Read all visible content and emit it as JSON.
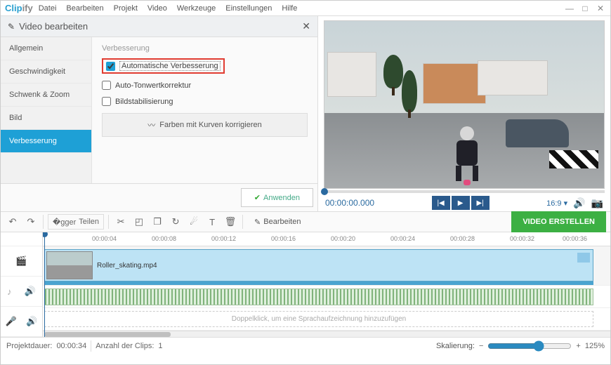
{
  "app": {
    "name1": "Clip",
    "name2": "ify"
  },
  "menu": [
    "Datei",
    "Bearbeiten",
    "Projekt",
    "Video",
    "Werkzeuge",
    "Einstellungen",
    "Hilfe"
  ],
  "panel": {
    "title": "Video bearbeiten",
    "tabs": [
      "Allgemein",
      "Geschwindigkeit",
      "Schwenk & Zoom",
      "Bild",
      "Verbesserung"
    ],
    "active_tab": 4,
    "group": "Verbesserung",
    "auto_enhance": "Automatische Verbesserung",
    "auto_tone": "Auto-Tonwertkorrektur",
    "stabilize": "Bildstabilisierung",
    "curves_btn": "Farben mit Kurven korrigieren",
    "apply": "Anwenden"
  },
  "preview": {
    "timecode": "00:00:00.000",
    "ratio": "16:9"
  },
  "toolbar": {
    "split": "Teilen",
    "edit": "Bearbeiten",
    "create": "VIDEO ERSTELLEN"
  },
  "timeline": {
    "ticks": [
      "00:00:04",
      "00:00:08",
      "00:00:12",
      "00:00:16",
      "00:00:20",
      "00:00:24",
      "00:00:28",
      "00:00:32",
      "00:00:36"
    ],
    "clip_name": "Roller_skating.mp4",
    "voice_hint": "Doppelklick, um eine Sprachaufzeichnung hinzuzufügen"
  },
  "status": {
    "duration_label": "Projektdauer:",
    "duration": "00:00:34",
    "clips_label": "Anzahl der Clips:",
    "clips": "1",
    "scale_label": "Skalierung:",
    "scale_value": "125%"
  }
}
